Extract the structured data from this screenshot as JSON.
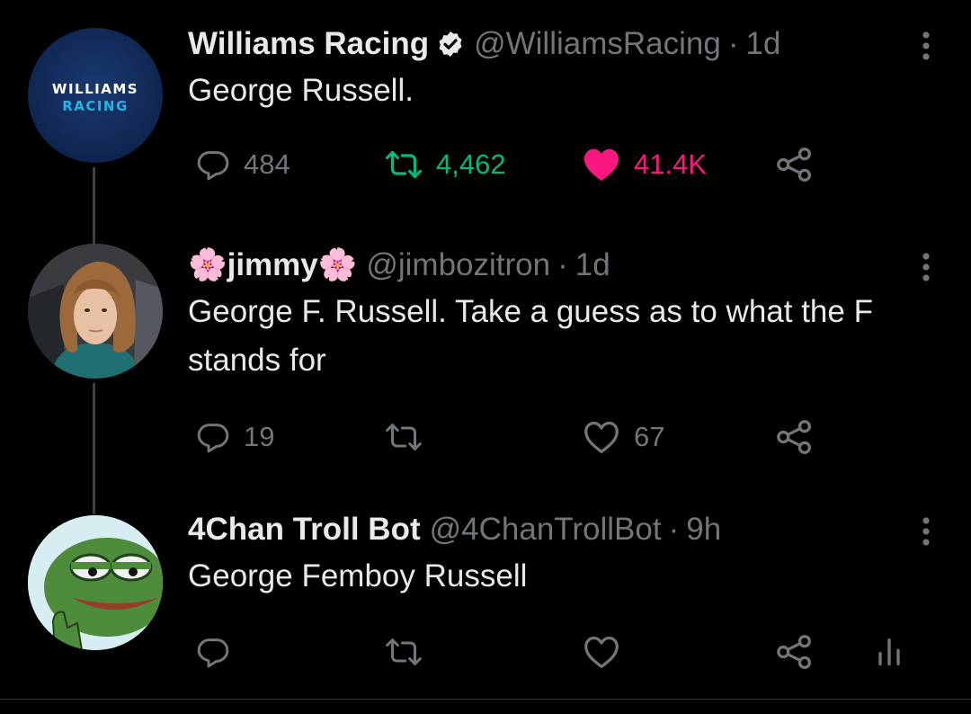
{
  "tweets": [
    {
      "avatar_text_line1": "WILLIAMS",
      "avatar_text_line2": "RACING",
      "name": "Williams Racing",
      "handle": "@WilliamsRacing",
      "separator": "·",
      "time": "1d",
      "text": "George Russell.",
      "replies": "484",
      "retweets": "4,462",
      "likes": "41.4K",
      "retweeted": true,
      "liked": true,
      "verified": true
    },
    {
      "name_prefix_emoji": "🌸",
      "name": "jimmy",
      "name_suffix_emoji": "🌸",
      "handle": "@jimbozitron",
      "separator": "·",
      "time": "1d",
      "text": "George F. Russell. Take a guess as to what the F stands for",
      "replies": "19",
      "retweets": "",
      "likes": "67"
    },
    {
      "name": "4Chan Troll Bot",
      "handle": "@4ChanTrollBot",
      "separator": "·",
      "time": "9h",
      "text": "George Femboy Russell",
      "replies": "",
      "retweets": "",
      "likes": ""
    }
  ],
  "colors": {
    "background": "#000000",
    "text_primary": "#e7e9ea",
    "text_secondary": "#71767b",
    "retweet_green": "#00ba7c",
    "like_pink": "#f91880",
    "thread_line": "#3e4144"
  },
  "icons": [
    "reply-icon",
    "retweet-icon",
    "like-icon",
    "share-icon",
    "analytics-icon",
    "more-icon",
    "verified-badge-icon"
  ]
}
